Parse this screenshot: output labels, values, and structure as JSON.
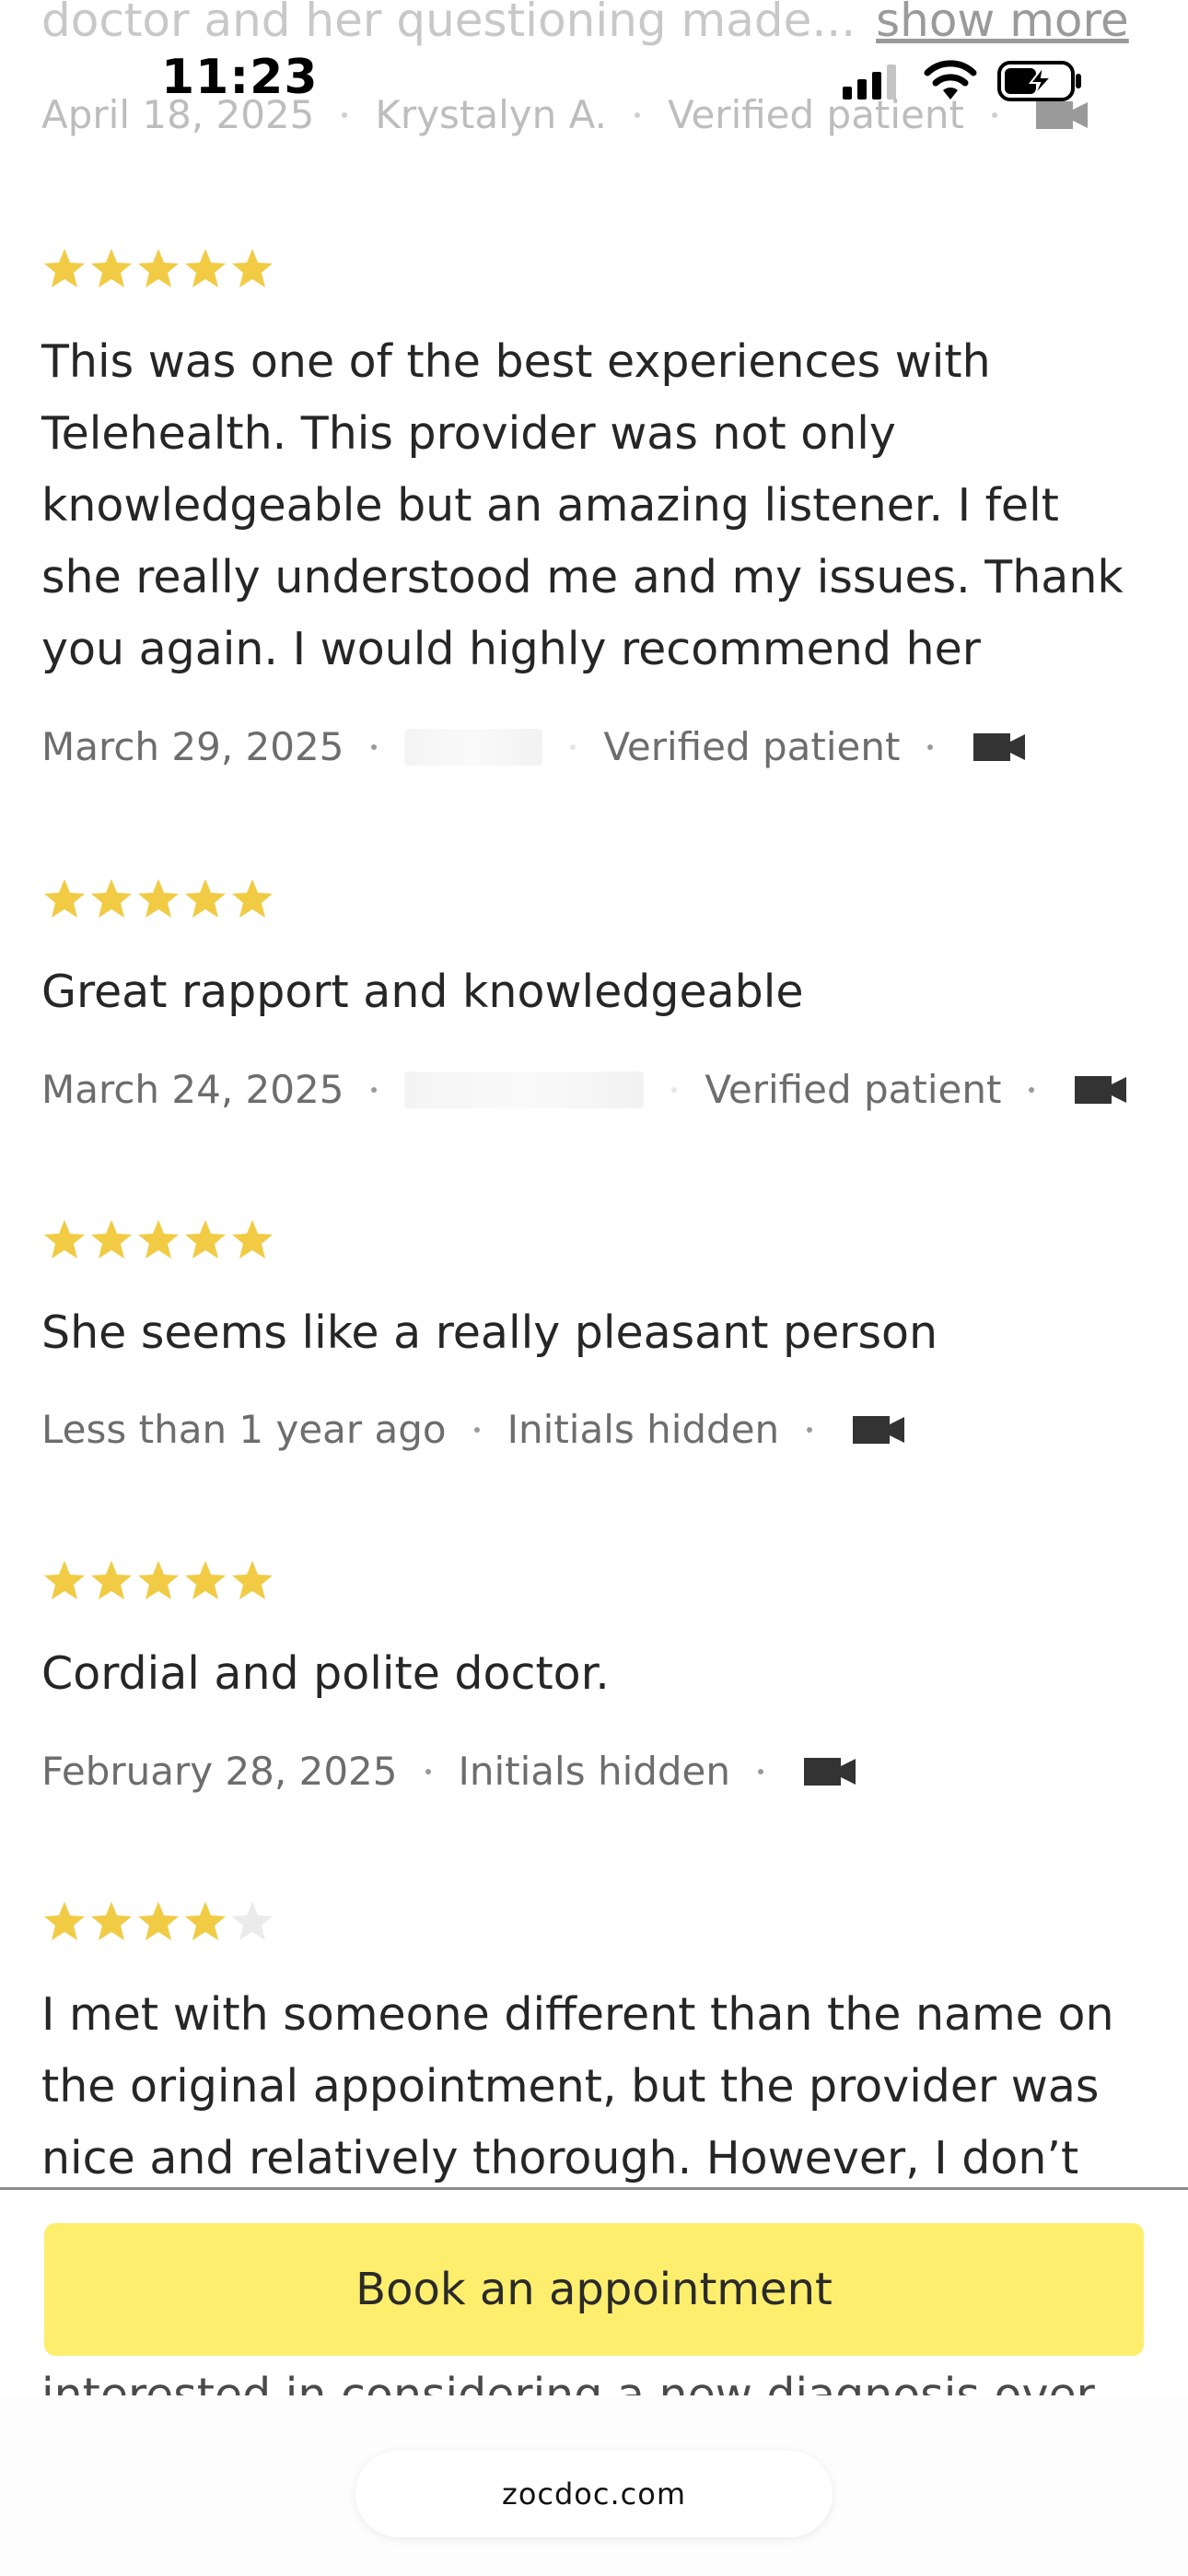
{
  "status_bar": {
    "time": "11:23"
  },
  "previous_review": {
    "text_tail": "doctor and her questioning made...",
    "show_more": "show more",
    "date": "April 18, 2025",
    "author": "Krystalyn A.",
    "verified": "Verified patient",
    "visit_icon": "video-camera-icon"
  },
  "reviews": [
    {
      "rating": 5,
      "text": "This was one of the best experiences with Telehealth. This provider was not only knowledgeable but an amazing listener. I felt she really understood me and my issues. Thank you again. I would highly recommend her",
      "date": "March 29, 2025",
      "author": "",
      "verified": "Verified patient",
      "visit_icon": "video-camera-icon"
    },
    {
      "rating": 5,
      "text": "Great rapport and knowledgeable",
      "date": "March 24, 2025",
      "author": "",
      "verified": "Verified patient",
      "visit_icon": "video-camera-icon"
    },
    {
      "rating": 5,
      "text": "She seems like a really pleasant person",
      "date": "Less than 1 year ago",
      "author": "Initials hidden",
      "visit_icon": "video-camera-icon"
    },
    {
      "rating": 5,
      "text": "Cordial and polite doctor.",
      "date": "February 28, 2025",
      "author": "Initials hidden",
      "visit_icon": "video-camera-icon"
    },
    {
      "rating": 4,
      "text": "I met with someone different than the name on the original appointment, but the provider was nice and relatively thorough. However, I don’t",
      "date": "",
      "author": "",
      "visit_icon": ""
    }
  ],
  "cut_off_text": "interested in considering a new diagnosis over",
  "book_button": "Book an appointment",
  "browser": {
    "url": "zocdoc.com"
  },
  "colors": {
    "star_filled": "#F2CB45",
    "star_empty": "#EBEBEB",
    "book_button_bg": "#FDEE6E"
  }
}
